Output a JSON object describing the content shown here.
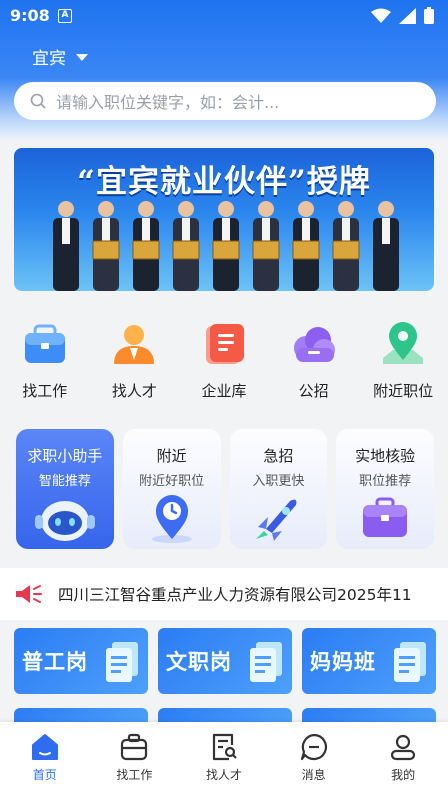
{
  "status_bar": {
    "time": "9:08",
    "notification_badge": "A",
    "icons": [
      "wifi-icon",
      "signal-icon",
      "battery-icon"
    ]
  },
  "location": {
    "city": "宜宾"
  },
  "search": {
    "placeholder": "请输入职位关键字，如：会计..."
  },
  "banner": {
    "title": "“宜宾就业伙伴”授牌"
  },
  "quick_menu": [
    {
      "label": "找工作",
      "icon": "briefcase-icon"
    },
    {
      "label": "找人才",
      "icon": "person-icon"
    },
    {
      "label": "企业库",
      "icon": "document-icon"
    },
    {
      "label": "公招",
      "icon": "cloud-icon"
    },
    {
      "label": "附近职位",
      "icon": "map-pin-icon"
    }
  ],
  "feature_cards": [
    {
      "title": "求职小助手",
      "subtitle": "智能推荐",
      "icon": "robot-icon"
    },
    {
      "title": "附近",
      "subtitle": "附近好职位",
      "icon": "location-clock-icon"
    },
    {
      "title": "急招",
      "subtitle": "入职更快",
      "icon": "rocket-icon"
    },
    {
      "title": "实地核验",
      "subtitle": "职位推荐",
      "icon": "suitcase-icon"
    }
  ],
  "notice": {
    "text": "四川三江智谷重点产业人力资源有限公司2025年11",
    "icon": "megaphone-icon"
  },
  "job_categories": [
    {
      "label": "普工岗"
    },
    {
      "label": "文职岗"
    },
    {
      "label": "妈妈班"
    }
  ],
  "tabbar": [
    {
      "label": "首页",
      "icon": "home-icon",
      "active": true
    },
    {
      "label": "找工作",
      "icon": "briefcase-icon",
      "active": false
    },
    {
      "label": "找人才",
      "icon": "resume-search-icon",
      "active": false
    },
    {
      "label": "消息",
      "icon": "message-icon",
      "active": false
    },
    {
      "label": "我的",
      "icon": "user-icon",
      "active": false
    }
  ],
  "colors": {
    "primary": "#2f6cf0",
    "header_top": "#1f73f0",
    "page_bg": "#f2f3f5",
    "notice_red": "#e8384f"
  }
}
